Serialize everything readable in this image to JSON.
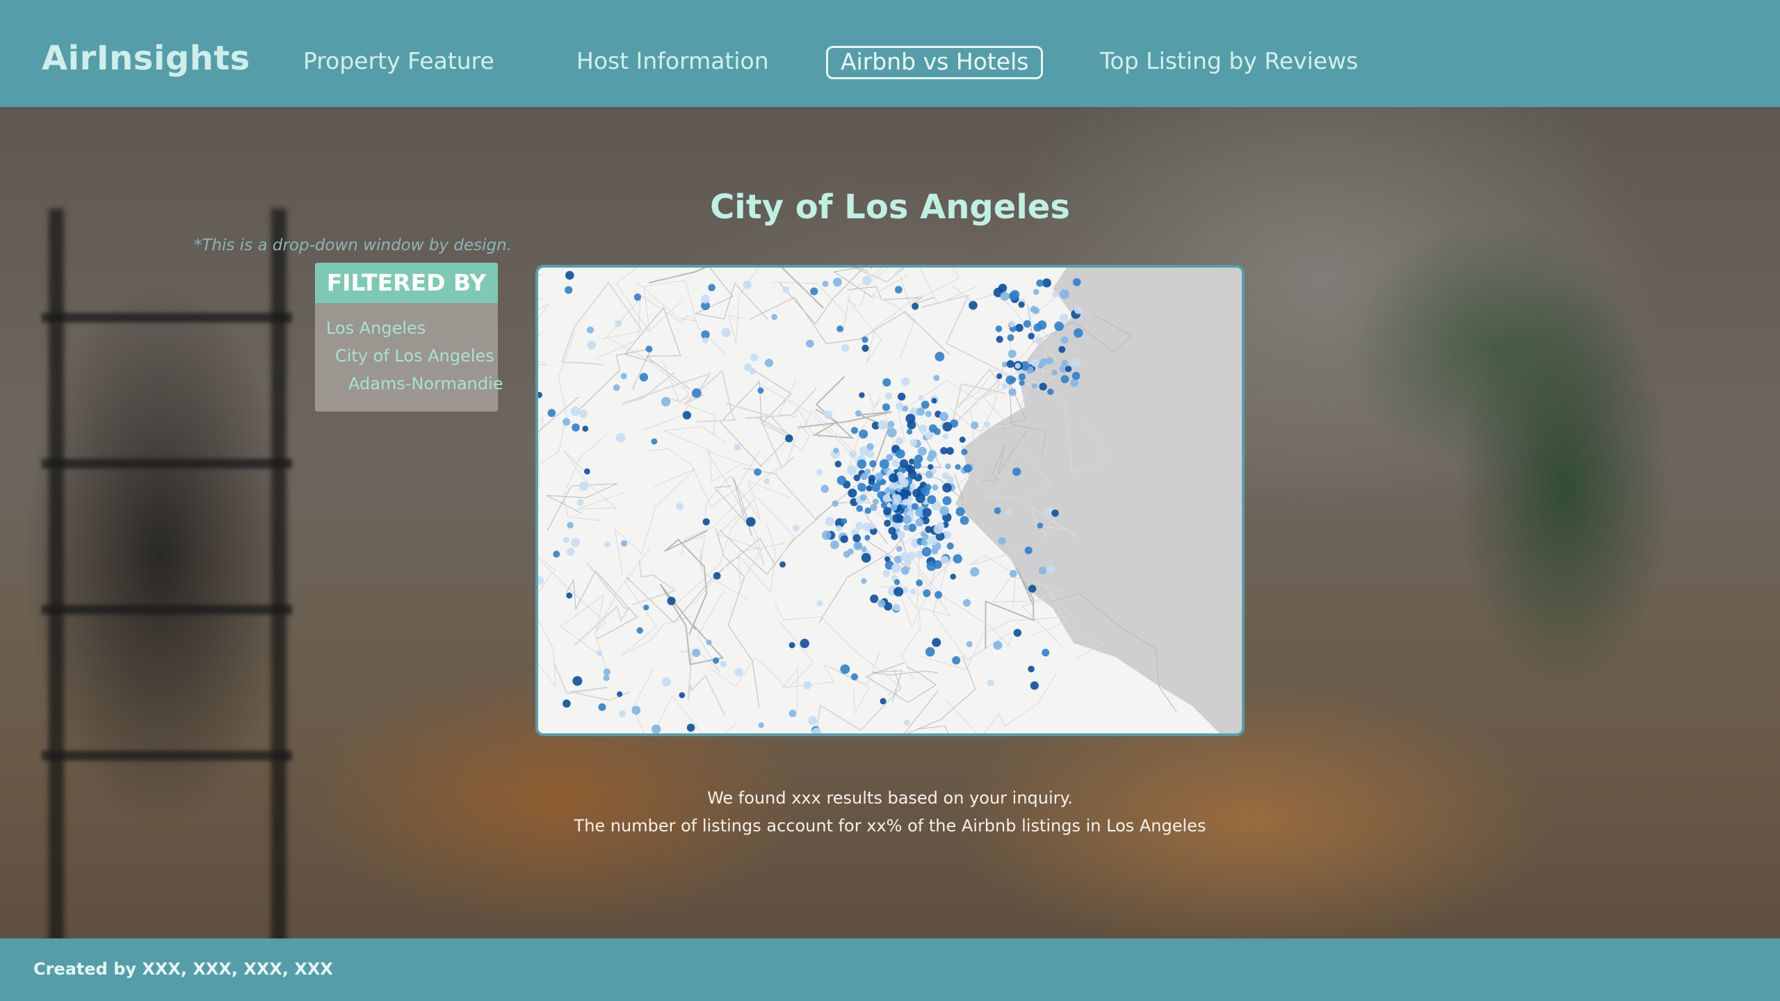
{
  "header": {
    "brand": "AirInsights",
    "nav": [
      {
        "label": "Property Feature",
        "active": false
      },
      {
        "label": "Host Information",
        "active": false
      },
      {
        "label": "Airbnb vs Hotels",
        "active": true
      },
      {
        "label": "Top Listing by Reviews",
        "active": false
      }
    ]
  },
  "main": {
    "title": "City of Los Angeles",
    "dropdown_note": "*This is a drop-down window by design.",
    "filter": {
      "heading": "FILTERED BY",
      "items": [
        "Los Angeles",
        "City of Los Angeles",
        "Adams-Normandie"
      ]
    },
    "map": {
      "description_icon": "map-with-listing-dots",
      "dot_colors": [
        "#0b4f9e",
        "#2f7fcb",
        "#7fb6e6",
        "#c7ddf3"
      ],
      "water_color": "#cfcfcf"
    },
    "results": {
      "line1": "We found xxx results based on your inquiry.",
      "line2": "The number of listings account for xx% of the Airbnb listings in Los Angeles"
    }
  },
  "footer": {
    "credit": "Created by XXX, XXX, XXX, XXX"
  },
  "colors": {
    "header_bg": "#559ea9",
    "brand_text": "#cdeee9",
    "title_text": "#bff0e3",
    "filter_head_bg": "#7dc9b3",
    "filter_item_text": "#a9e2cf"
  }
}
